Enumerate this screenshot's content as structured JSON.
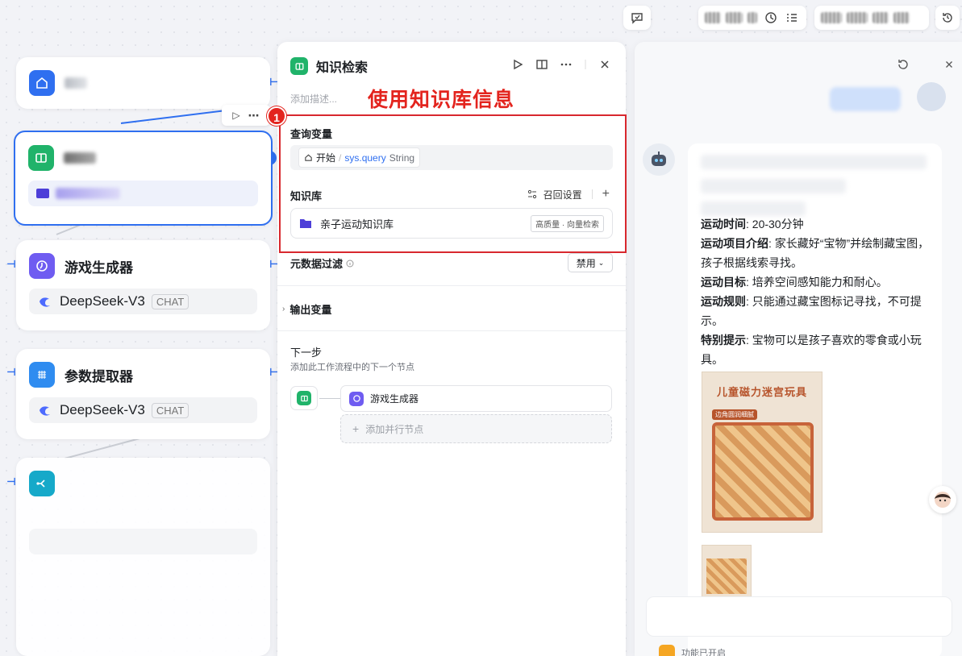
{
  "canvas": {
    "nodes": [
      {
        "title": "",
        "icon": "home-icon",
        "color": "#2f6ff0"
      },
      {
        "title": "",
        "icon": "book-icon",
        "color": "#20b36a",
        "selected": true
      },
      {
        "title": "游戏生成器",
        "icon": "info-icon",
        "color": "#6f5cf1",
        "model": "DeepSeek-V3",
        "badge": "CHAT"
      },
      {
        "title": "参数提取器",
        "icon": "grid-icon",
        "color": "#2f8cf0",
        "model": "DeepSeek-V3",
        "badge": "CHAT"
      },
      {
        "title": "",
        "icon": "branch-icon",
        "color": "#16a9c9"
      }
    ]
  },
  "panel": {
    "title": "知识检索",
    "description_placeholder": "添加描述...",
    "annotation_text": "使用知识库信息",
    "annotation_number": "1",
    "query_section_label": "查询变量",
    "query": {
      "source": "开始",
      "separator": "/",
      "variable": "sys.query",
      "type": "String"
    },
    "kb_section_label": "知识库",
    "recall_settings_label": "召回设置",
    "add_label": "+",
    "kb_items": [
      {
        "name": "亲子运动知识库",
        "tag": "高质量 · 向量检索"
      }
    ],
    "metadata_filter_label": "元数据过滤",
    "metadata_filter_value": "禁用",
    "output_variables_label": "输出变量",
    "next_step_label": "下一步",
    "next_step_desc": "添加此工作流程中的下一个节点",
    "next_node_label": "游戏生成器",
    "add_parallel_label": "添加并行节点"
  },
  "chat": {
    "message_lines": [
      {
        "label": "运动时间",
        "text": "20-30分钟"
      },
      {
        "label": "运动项目介绍",
        "text": "家长藏好“宝物”并绘制藏宝图，孩子根据线索寻找。"
      },
      {
        "label": "运动目标",
        "text": "培养空间感知能力和耐心。"
      },
      {
        "label": "运动规则",
        "text": "只能通过藏宝图标记寻找，不可提示。"
      },
      {
        "label": "特别提示",
        "text": "宝物可以是孩子喜欢的零食或小玩具。"
      }
    ],
    "poster_title": "儿童磁力迷宫玩具",
    "poster_subtitle": "边角圆润细腻",
    "footer_text": "功能已开启"
  },
  "colors": {
    "accent": "#2f6ff0",
    "annotation_red": "#e3241e",
    "knowledge_green": "#20b36a"
  }
}
